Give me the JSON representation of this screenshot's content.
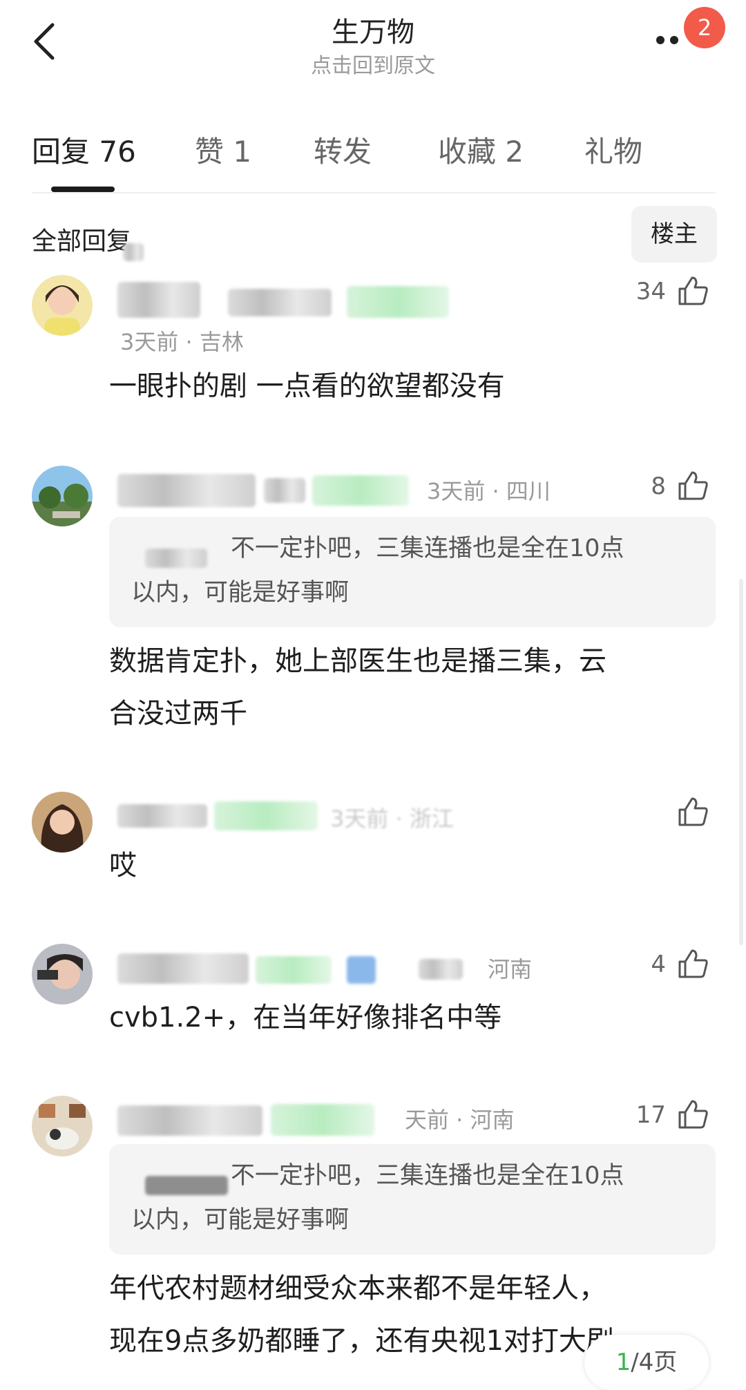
{
  "header": {
    "title": "生万物",
    "subtitle": "点击回到原文",
    "notification_count": "2"
  },
  "tabs": [
    {
      "label": "回复 76",
      "active": true
    },
    {
      "label": "赞 1"
    },
    {
      "label": "转发"
    },
    {
      "label": "收藏 2"
    },
    {
      "label": "礼物"
    }
  ],
  "filter": {
    "all_replies": "全部回复",
    "owner_only": "楼主"
  },
  "comments": [
    {
      "meta": "3天前 · 吉林",
      "likes": "34",
      "content": "一眼扑的剧 一点看的欲望都没有"
    },
    {
      "meta": "3天前 · 四川",
      "likes": "8",
      "quote_line1": "不一定扑吧，三集连播也是全在10点",
      "quote_line2": "以内，可能是好事啊",
      "content_line1": "数据肯定扑，她上部医生也是播三集，云",
      "content_line2": "合没过两千"
    },
    {
      "meta": "3天前 · 浙江",
      "likes": "",
      "content": "哎"
    },
    {
      "meta": "河南",
      "likes": "4",
      "content": "cvb1.2+，在当年好像排名中等"
    },
    {
      "meta": "天前 · 河南",
      "likes": "17",
      "quote_line1": "不一定扑吧，三集连播也是全在10点",
      "quote_line2": "以内，可能是好事啊",
      "content_line1": "年代农村题材细受众本来都不是年轻人，",
      "content_line2": "现在9点多奶都睡了，还有央视1对打大剧"
    }
  ],
  "pager": {
    "current": "1",
    "total": "/4页"
  },
  "colors": {
    "accent_green": "#39b54a",
    "badge_red": "#f25a4a"
  }
}
